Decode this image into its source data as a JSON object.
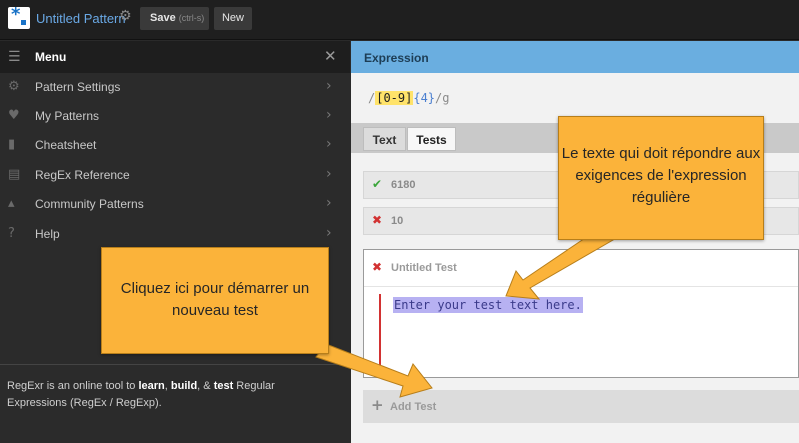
{
  "header": {
    "title": "Untitled Pattern",
    "save_label": "Save",
    "save_hint": "(ctrl-s)",
    "new_label": "New"
  },
  "sidebar": {
    "menu_title": "Menu",
    "items": [
      {
        "label": "Pattern Settings",
        "icon": "gear-icon"
      },
      {
        "label": "My Patterns",
        "icon": "heart-icon"
      },
      {
        "label": "Cheatsheet",
        "icon": "book-icon"
      },
      {
        "label": "RegEx Reference",
        "icon": "document-icon"
      },
      {
        "label": "Community Patterns",
        "icon": "community-icon"
      },
      {
        "label": "Help",
        "icon": "help-icon"
      }
    ],
    "about": {
      "pre": "RegExr is an online tool to ",
      "learn": "learn",
      "sep1": ", ",
      "build": "build",
      "sep2": ", & ",
      "test": "test",
      "post": " Regular Expressions (RegEx / RegExp)."
    }
  },
  "expression": {
    "header": "Expression",
    "open": "/",
    "class": "[0-9]",
    "quantifier": "{4}",
    "close": "/",
    "flags": "g"
  },
  "tabs": [
    {
      "label": "Text"
    },
    {
      "label": "Tests"
    }
  ],
  "tests": [
    {
      "value": "6180",
      "status": "pass",
      "mark": "✔"
    },
    {
      "value": "10",
      "status": "fail",
      "mark": "✖"
    }
  ],
  "editing_test": {
    "name": "Untitled Test",
    "mark": "✖",
    "placeholder": "Enter your test text here."
  },
  "add_test_label": "Add Test",
  "callouts": {
    "right": "Le texte qui doit répondre aux exigences de l'expression régulière",
    "left": "Cliquez ici pour démarrer un nouveau test"
  },
  "colors": {
    "accent": "#6aaee0",
    "callout": "#fbb33a",
    "pass": "#3aa53a",
    "fail": "#d23232"
  }
}
